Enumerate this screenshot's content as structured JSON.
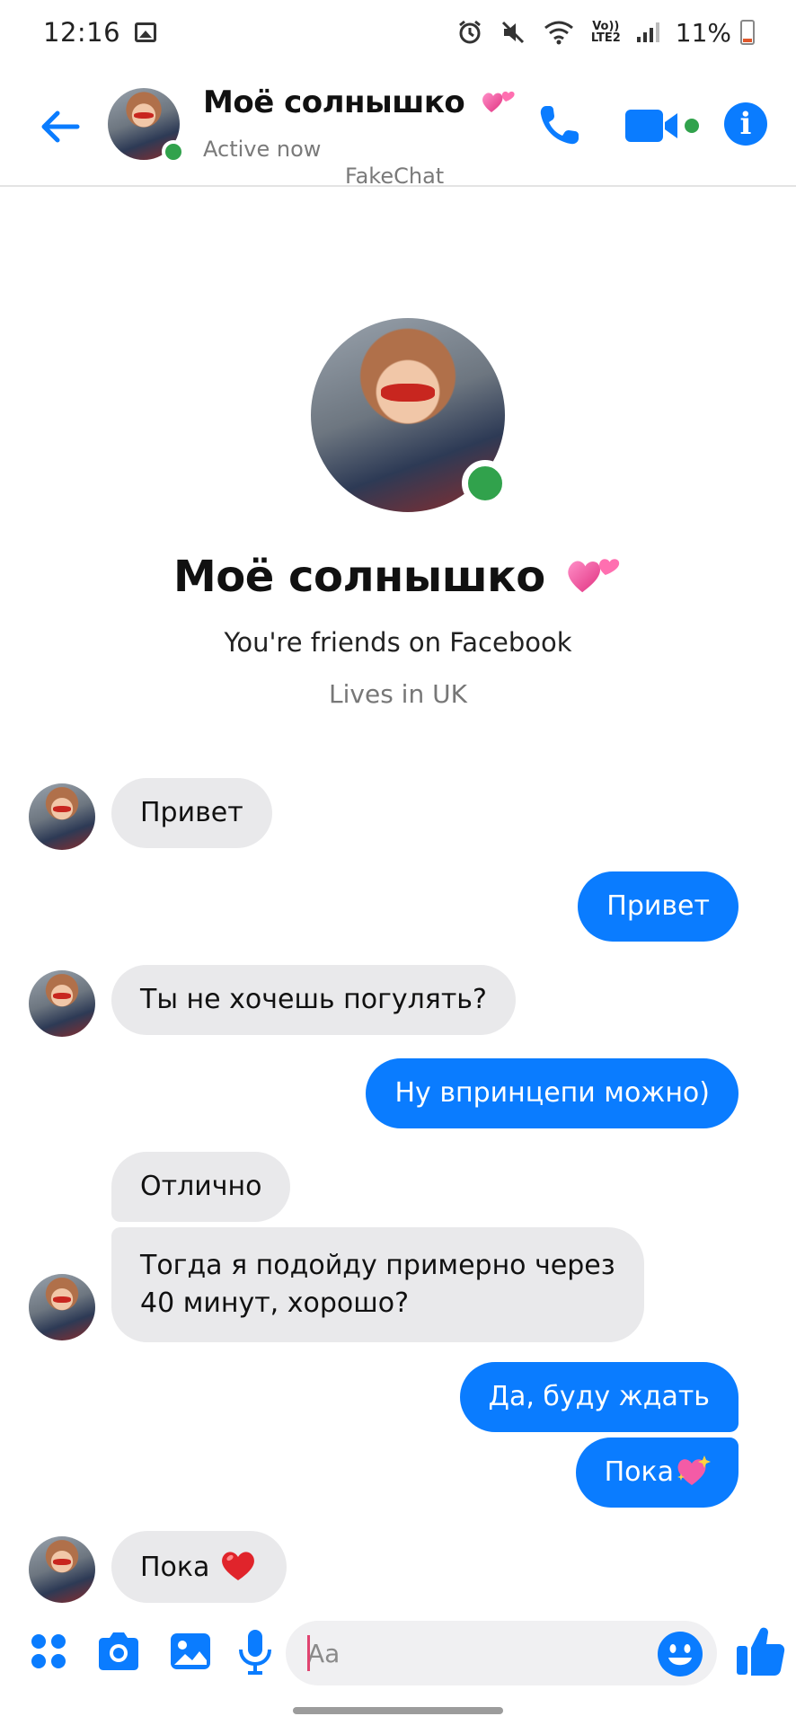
{
  "status_bar": {
    "time": "12:16",
    "network_top": "Vo))",
    "network_bottom": "LTE2",
    "battery": "11%"
  },
  "header": {
    "contact_name": "Моё солнышко",
    "status": "Active now",
    "watermark": "FakeChat",
    "icons": [
      "back-arrow-icon",
      "phone-icon",
      "video-camera-icon",
      "info-icon"
    ]
  },
  "profile": {
    "name": "Моё солнышко",
    "friends_text": "You're friends on Facebook",
    "location": "Lives in UK"
  },
  "messages": [
    {
      "direction": "in",
      "text": "Привет"
    },
    {
      "direction": "out",
      "text": "Привет"
    },
    {
      "direction": "in",
      "text": "Ты не хочешь погулять?"
    },
    {
      "direction": "out",
      "text": "Ну впринцепи можно)"
    },
    {
      "direction": "in",
      "text": "Отлично"
    },
    {
      "direction": "in",
      "line1": "Тогда я подойду примерно через",
      "line2": "40 минут, хорошо?"
    },
    {
      "direction": "out",
      "text": "Да, буду ждать"
    },
    {
      "direction": "out",
      "text": "Пока",
      "emoji": "sparkling-heart-icon"
    },
    {
      "direction": "in",
      "text": "Пока",
      "emoji": "red-heart-icon"
    }
  ],
  "composer": {
    "placeholder": "Aa",
    "icons": [
      "apps-grid-icon",
      "camera-icon",
      "gallery-icon",
      "microphone-icon",
      "emoji-icon",
      "thumbs-up-icon"
    ]
  },
  "colors": {
    "accent": "#0a7cff",
    "incoming_bubble": "#e9e9eb",
    "online": "#31a24c"
  }
}
